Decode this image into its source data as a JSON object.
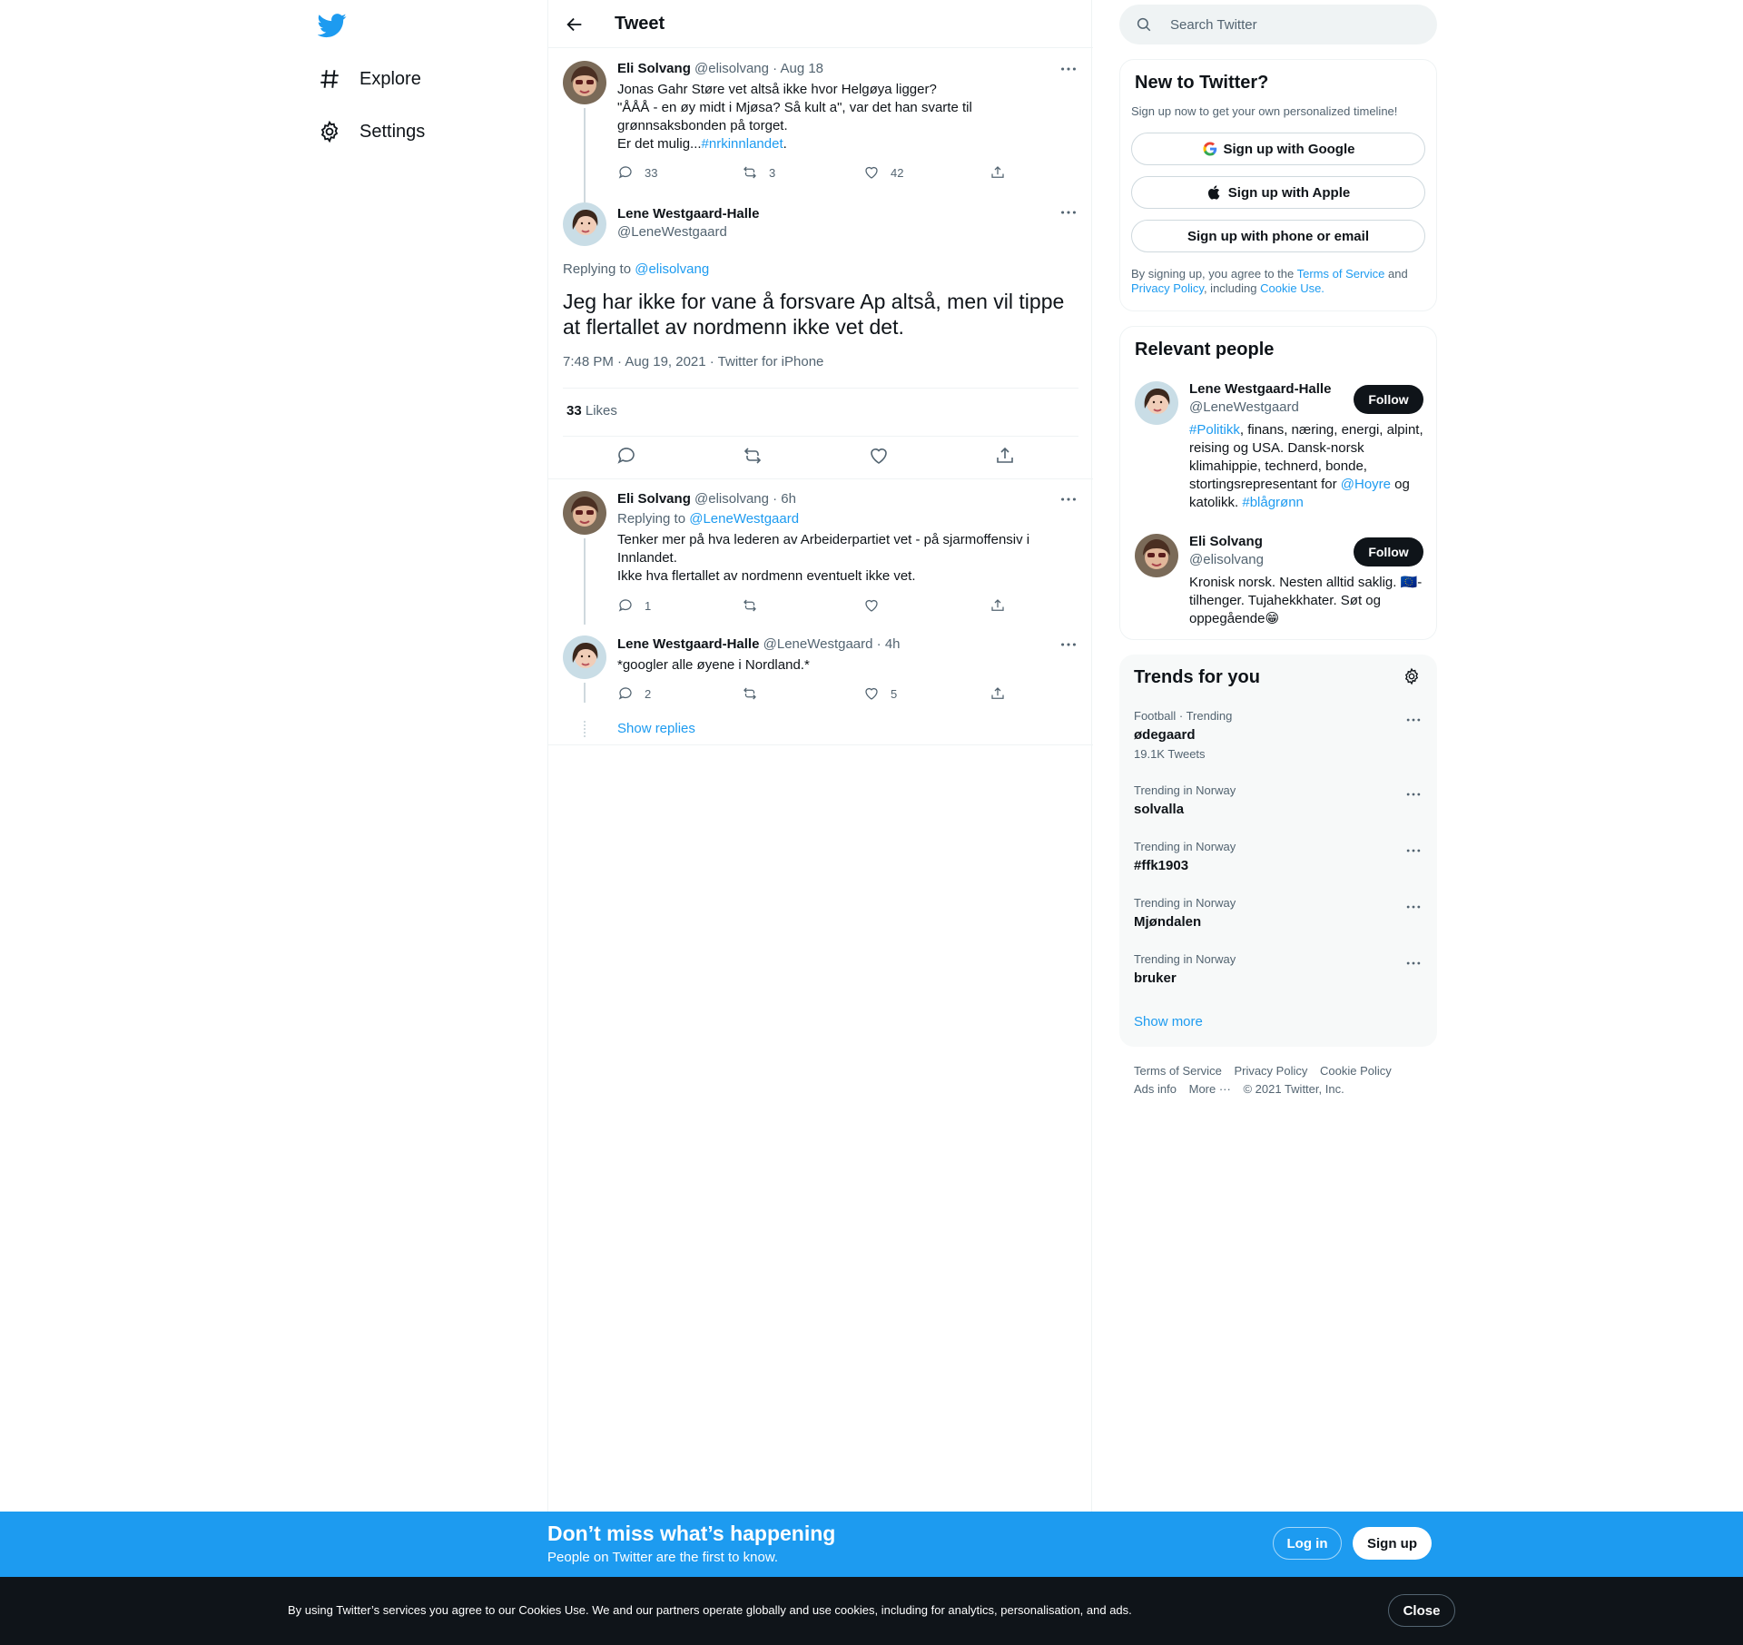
{
  "nav": {
    "items": [
      {
        "label": "Explore",
        "icon": "hashtag-icon"
      },
      {
        "label": "Settings",
        "icon": "gear-icon"
      }
    ]
  },
  "header": {
    "title": "Tweet"
  },
  "tweets": {
    "parent": {
      "name": "Eli Solvang",
      "handle": "@elisolvang",
      "time": "· Aug 18",
      "text_1": "Jonas Gahr Støre vet altså ikke hvor Helgøya ligger?\n\"ÅÅÅ - en øy midt i Mjøsa? Så kult a\", var det han svarte til grønnsaksbonden på torget.\nEr det mulig...",
      "hashtag": "#nrkinnlandet",
      "text_2": ".",
      "replies": "33",
      "retweets": "3",
      "likes": "42"
    },
    "main": {
      "name": "Lene Westgaard-Halle",
      "handle": "@LeneWestgaard",
      "replying_label": "Replying to",
      "replying_to": "@elisolvang",
      "text": "Jeg har ikke for vane å forsvare Ap altså, men vil tippe at flertallet av nordmenn ikke vet det.",
      "meta": "7:48 PM · Aug 19, 2021 · Twitter for iPhone",
      "likes_count": "33",
      "likes_label": "Likes"
    },
    "reply1": {
      "name": "Eli Solvang",
      "handle": "@elisolvang",
      "time": "· 6h",
      "replying_label": "Replying to",
      "replying_to": "@LeneWestgaard",
      "text": "Tenker mer på hva lederen av Arbeiderpartiet vet - på sjarmoffensiv i Innlandet.\nIkke hva flertallet av nordmenn eventuelt ikke vet.",
      "replies": "1"
    },
    "reply2": {
      "name": "Lene Westgaard-Halle",
      "handle": "@LeneWestgaard",
      "time": "· 4h",
      "text": "*googler alle øyene i Nordland.*",
      "replies": "2",
      "likes": "5",
      "show_replies": "Show replies"
    }
  },
  "search": {
    "placeholder": "Search Twitter"
  },
  "new_to_twitter": {
    "title": "New to Twitter?",
    "subtitle": "Sign up now to get your own personalized timeline!",
    "google": "Sign up with Google",
    "apple": "Sign up with Apple",
    "phone": "Sign up with phone or email",
    "legal_1": "By signing up, you agree to the ",
    "tos": "Terms of Service",
    "legal_2": " and ",
    "privacy": "Privacy Policy",
    "legal_3": ", including ",
    "cookie": "Cookie Use."
  },
  "relevant": {
    "title": "Relevant people",
    "follow_label": "Follow",
    "p1": {
      "name": "Lene Westgaard-Halle",
      "handle": "@LeneWestgaard",
      "bio_tag1": "#Politikk",
      "bio_1": ", finans, næring, energi, alpint, reising og USA. Dansk-norsk klimahippie, technerd, bonde, stortingsrepresentant for ",
      "bio_mention": "@Hoyre",
      "bio_2": " og katolikk. ",
      "bio_tag2": "#blågrønn"
    },
    "p2": {
      "name": "Eli Solvang",
      "handle": "@elisolvang",
      "bio_1": "Kronisk norsk. Nesten alltid saklig. ",
      "bio_flag": "🇪🇺",
      "bio_2": "-tilhenger. Tujahekkhater. Søt og oppegående",
      "bio_emoji": "😁"
    }
  },
  "trends": {
    "title": "Trends for you",
    "items": [
      {
        "meta": "Football · Trending",
        "name": "ødegaard",
        "count": "19.1K Tweets"
      },
      {
        "meta": "Trending in Norway",
        "name": "solvalla"
      },
      {
        "meta": "Trending in Norway",
        "name": "#ffk1903"
      },
      {
        "meta": "Trending in Norway",
        "name": "Mjøndalen"
      },
      {
        "meta": "Trending in Norway",
        "name": "bruker"
      }
    ],
    "show_more": "Show more"
  },
  "footer": {
    "links": [
      "Terms of Service",
      "Privacy Policy",
      "Cookie Policy",
      "Ads info",
      "More ···"
    ],
    "copyright": "© 2021 Twitter, Inc."
  },
  "bottom_bar": {
    "title": "Don’t miss what’s happening",
    "subtitle": "People on Twitter are the first to know.",
    "login": "Log in",
    "signup": "Sign up"
  },
  "cookie_bar": {
    "text": "By using Twitter’s services you agree to our Cookies Use. We and our partners operate globally and use cookies, including for analytics, personalisation, and ads.",
    "close": "Close"
  },
  "colors": {
    "accent": "#1d9bf0",
    "text": "#0f1419",
    "muted": "#536471",
    "dark": "#0f1419"
  }
}
